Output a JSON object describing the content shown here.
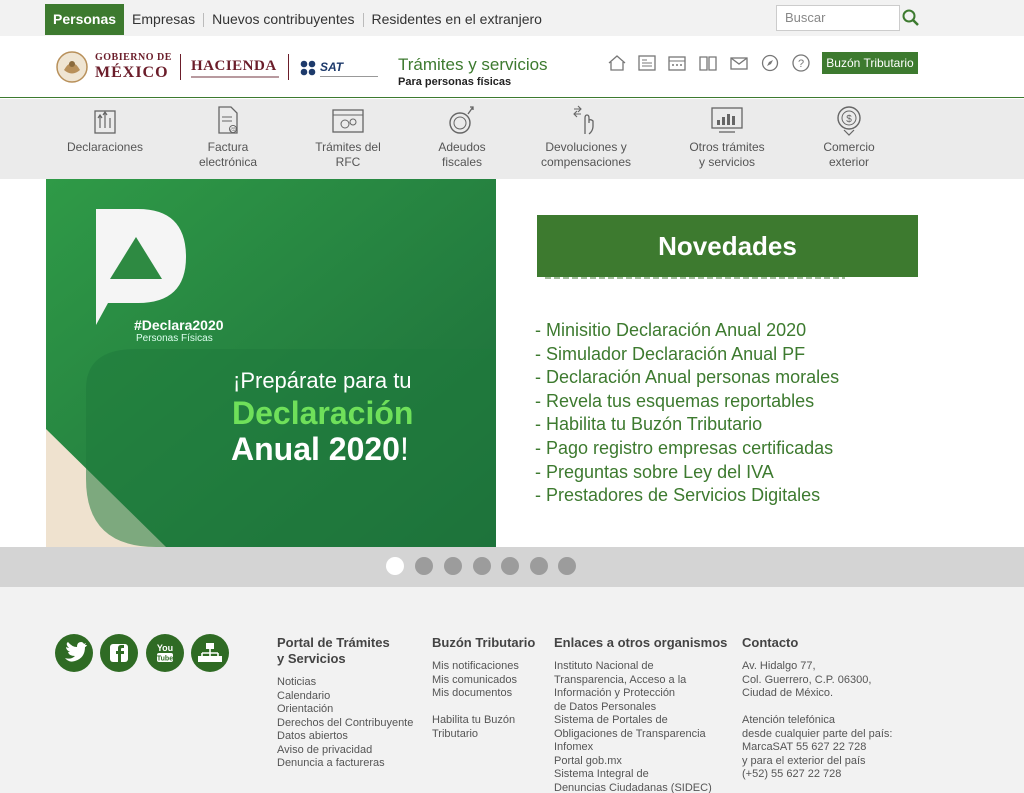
{
  "topnav": {
    "items": [
      "Personas",
      "Empresas",
      "Nuevos contribuyentes",
      "Residentes en el extranjero"
    ],
    "search_placeholder": "Buscar"
  },
  "header": {
    "gob_line1": "GOBIERNO DE",
    "gob_line2": "MÉXICO",
    "hacienda": "HACIENDA",
    "sat": "SAT",
    "title": "Trámites y servicios",
    "subtitle": "Para personas físicas",
    "buzon_button": "Buzón Tributario",
    "icons": [
      "home-icon",
      "news-icon",
      "calendar-icon",
      "book-icon",
      "mail-icon",
      "compass-icon",
      "help-icon"
    ]
  },
  "categories": [
    {
      "label": "Declaraciones",
      "icon": "declaraciones-icon"
    },
    {
      "label": "Factura\nelectrónica",
      "icon": "factura-icon"
    },
    {
      "label": "Trámites del\nRFC",
      "icon": "rfc-icon"
    },
    {
      "label": "Adeudos\nfiscales",
      "icon": "adeudos-icon"
    },
    {
      "label": "Devoluciones y\ncompensaciones",
      "icon": "devoluciones-icon"
    },
    {
      "label": "Otros trámites\ny servicios",
      "icon": "otros-icon"
    },
    {
      "label": "Comercio\nexterior",
      "icon": "comercio-icon"
    }
  ],
  "hero": {
    "hashtag": "#Declara2020",
    "hashtag_sub": "Personas Físicas",
    "line1": "¡Prepárate para tu",
    "line2": "Declaración",
    "line3": "Anual 2020",
    "line3_end": "!"
  },
  "novedades": {
    "title": "Novedades",
    "items": [
      "- Minisitio Declaración Anual 2020",
      "- Simulador Declaración Anual PF",
      "- Declaración Anual personas morales",
      "- Revela tus esquemas reportables",
      "- Habilita tu Buzón Tributario",
      "- Pago registro empresas certificadas",
      "- Preguntas sobre Ley del IVA",
      "- Prestadores de Servicios Digitales"
    ]
  },
  "slider": {
    "count": 7,
    "active": 1
  },
  "footer": {
    "social": [
      "twitter-icon",
      "facebook-icon",
      "youtube-icon",
      "sitemap-icon"
    ],
    "col1": {
      "heading": "Portal de Trámites\ny Servicios",
      "items": [
        "Noticias",
        "Calendario",
        "Orientación",
        "Derechos del Contribuyente",
        "Datos abiertos",
        "Aviso de privacidad",
        "Denuncia a factureras"
      ]
    },
    "col2": {
      "heading": "Buzón Tributario",
      "items": [
        "Mis notificaciones",
        "Mis comunicados",
        "Mis documentos"
      ],
      "items2": [
        "Habilita tu Buzón",
        "Tributario"
      ]
    },
    "col3": {
      "heading": "Enlaces a otros organismos",
      "items": [
        "Instituto Nacional de",
        "Transparencia, Acceso a la",
        "Información y Protección",
        "de Datos Personales",
        "Sistema de Portales de",
        "Obligaciones de Transparencia",
        "Infomex",
        "Portal gob.mx",
        "Sistema Integral de",
        "Denuncias Ciudadanas (SIDEC)"
      ]
    },
    "col4": {
      "heading": "Contacto",
      "address": [
        "Av. Hidalgo 77,",
        "Col. Guerrero, C.P. 06300,",
        "Ciudad de México."
      ],
      "phone": [
        "Atención telefónica",
        "desde cualquier parte del país:",
        "MarcaSAT 55 627 22 728",
        "y para el exterior del país",
        "(+52) 55 627 22 728"
      ]
    }
  },
  "colors": {
    "accent": "#3d7a2f",
    "gob": "#6b1d2a",
    "hero_green": "#2e8a42"
  }
}
